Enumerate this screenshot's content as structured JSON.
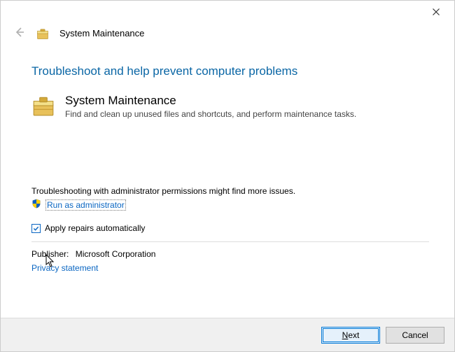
{
  "window": {
    "header_title": "System Maintenance"
  },
  "main": {
    "heading": "Troubleshoot and help prevent computer problems",
    "troubleshooter": {
      "title": "System Maintenance",
      "description": "Find and clean up unused files and shortcuts, and perform maintenance tasks."
    }
  },
  "admin": {
    "note": "Troubleshooting with administrator permissions might find more issues.",
    "link": "Run as administrator"
  },
  "checkbox": {
    "label": "Apply repairs automatically",
    "checked": true
  },
  "publisher": {
    "label": "Publisher:",
    "value": "Microsoft Corporation"
  },
  "privacy": {
    "label": "Privacy statement"
  },
  "buttons": {
    "next_prefix": "N",
    "next_rest": "ext",
    "cancel": "Cancel"
  }
}
